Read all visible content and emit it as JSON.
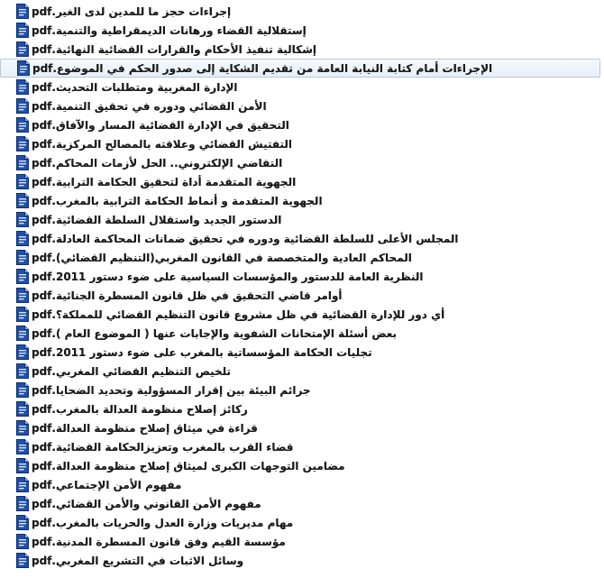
{
  "files": [
    {
      "name": "إجراءات حجز ما للمدين لدى الغير.pdf"
    },
    {
      "name": "إستقلالية القضاء ورهانات الديمقراطية والتنمية.pdf"
    },
    {
      "name": "إشكالية تنفيذ الأحكام والقرارات القضائية النهائية.pdf"
    },
    {
      "name": "الإجراءات أمام كتابة النيابة العامة من تقديم الشكاية إلى صدور الحكم في الموضوع.pdf",
      "selected": true
    },
    {
      "name": "الإدارة المغربية ومتطلبات التحديث.pdf"
    },
    {
      "name": "الأمن القضائي ودوره في تحقيق التنمية.pdf"
    },
    {
      "name": "التحقيق في الإدارة القضائية المسار والآفاق.pdf"
    },
    {
      "name": "التفتيش القضائي وعلاقته بالمصالح المركزية.pdf"
    },
    {
      "name": "التقاضي الإلكتروني.. الحل لأزمات المحاكم.pdf"
    },
    {
      "name": "الجهوية المتقدمة أداة لتحقيق الحكامة الترابية.pdf"
    },
    {
      "name": "الجهوية المتقدمة و أنماط الحكامة الترابية بالمغرب.pdf"
    },
    {
      "name": "الدستور الجديد واستقلال السلطة القضائية.pdf"
    },
    {
      "name": "المجلس الأعلى للسلطة القضائية ودوره في تحقيق ضمانات المحاكمة العادلة.pdf"
    },
    {
      "name": "المحاكم العادية والمتخصصة في القانون المغربي(التنظيم القضائي).pdf"
    },
    {
      "name": "النظرية العامة للدستور والمؤسسات السياسية على ضوء دستور 2011.pdf"
    },
    {
      "name": "أوامر قاضي التحقيق في ظل قانون المسطرة الجنائية.pdf"
    },
    {
      "name": "أي دور للإدارة القضائية في ظل مشروع قانون التنظيم القضائي للمملكة؟.pdf"
    },
    {
      "name": "بعض أسئلة الإمتحانات الشفوية والإجابات عنها ( الموضوع العام ).pdf"
    },
    {
      "name": "تجليات الحكامة المؤسساتية بالمغرب على ضوء دستور 2011.pdf"
    },
    {
      "name": "تلخيص التنظيم القضائي المغربي.pdf"
    },
    {
      "name": "جرائم البيئة بين إقرار المسؤولية وتحديد الضحايا.pdf"
    },
    {
      "name": "ركائز إصلاح منظومة العدالة بالمغرب.pdf"
    },
    {
      "name": "قراءة في ميثاق إصلاح منظومة العدالة.pdf"
    },
    {
      "name": "قضاء القرب بالمغرب وتعزيزالحكامة القضائية.pdf"
    },
    {
      "name": "مضامين التوجهات الكبرى لميثاق إصلاح منظومة العدالة.pdf"
    },
    {
      "name": "مفهوم الأمن الإجتماعي.pdf"
    },
    {
      "name": "مفهوم الأمن القانوني والأمن القضائي.pdf"
    },
    {
      "name": "مهام مديريات وزارة العدل والحريات بالمغرب.pdf"
    },
    {
      "name": "مؤسسة القيم وفق قانون المسطرة المدنية.pdf"
    },
    {
      "name": "وسائل الاثبات في التشريع المغربي.pdf"
    }
  ],
  "colors": {
    "icon_blue": "#1f4fa8",
    "icon_dark": "#0d2f72",
    "selection_border": "#b7c8dd"
  },
  "icon": "pdf-file-icon"
}
